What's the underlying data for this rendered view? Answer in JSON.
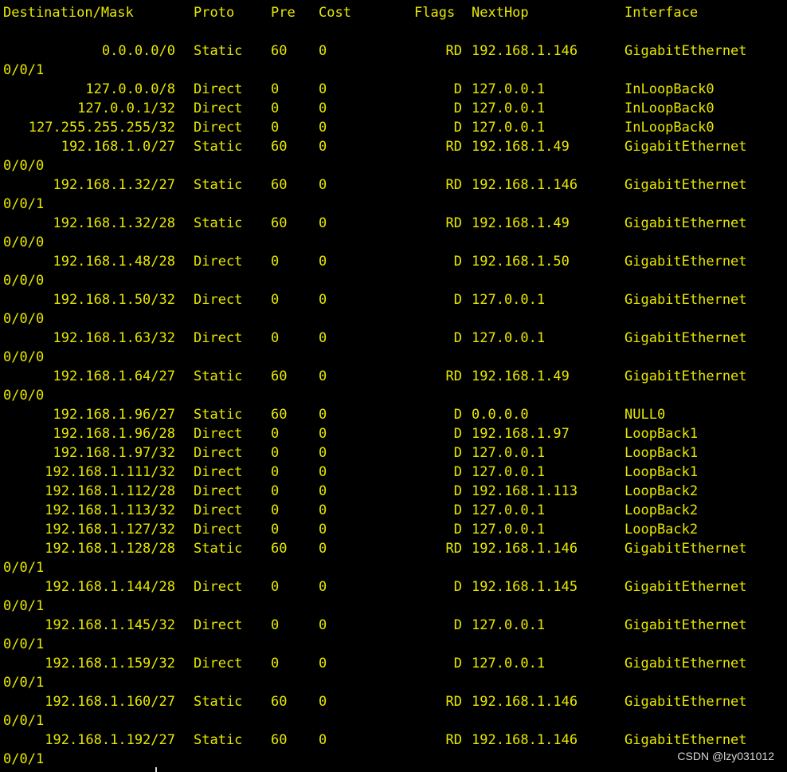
{
  "terminal": {
    "colors": {
      "background": "#000000",
      "text": "#e8e800",
      "watermark": "#d6d6d6"
    },
    "header": {
      "destination": "Destination/Mask",
      "proto": "Proto",
      "pre": "Pre",
      "cost": "Cost",
      "flags": "Flags",
      "nexthop": "NextHop",
      "interface": "Interface"
    },
    "routes": [
      {
        "dest": "0.0.0.0/0",
        "proto": "Static",
        "pre": "60",
        "cost": "0",
        "flags": "RD",
        "nexthop": "192.168.1.146",
        "iface": "GigabitEthernet",
        "iface_wrap": "0/0/1"
      },
      {
        "dest": "127.0.0.0/8",
        "proto": "Direct",
        "pre": "0",
        "cost": "0",
        "flags": "D",
        "nexthop": "127.0.0.1",
        "iface": "InLoopBack0",
        "iface_wrap": ""
      },
      {
        "dest": "127.0.0.1/32",
        "proto": "Direct",
        "pre": "0",
        "cost": "0",
        "flags": "D",
        "nexthop": "127.0.0.1",
        "iface": "InLoopBack0",
        "iface_wrap": ""
      },
      {
        "dest": "127.255.255.255/32",
        "proto": "Direct",
        "pre": "0",
        "cost": "0",
        "flags": "D",
        "nexthop": "127.0.0.1",
        "iface": "InLoopBack0",
        "iface_wrap": ""
      },
      {
        "dest": "192.168.1.0/27",
        "proto": "Static",
        "pre": "60",
        "cost": "0",
        "flags": "RD",
        "nexthop": "192.168.1.49",
        "iface": "GigabitEthernet",
        "iface_wrap": "0/0/0"
      },
      {
        "dest": "192.168.1.32/27",
        "proto": "Static",
        "pre": "60",
        "cost": "0",
        "flags": "RD",
        "nexthop": "192.168.1.146",
        "iface": "GigabitEthernet",
        "iface_wrap": "0/0/1"
      },
      {
        "dest": "192.168.1.32/28",
        "proto": "Static",
        "pre": "60",
        "cost": "0",
        "flags": "RD",
        "nexthop": "192.168.1.49",
        "iface": "GigabitEthernet",
        "iface_wrap": "0/0/0"
      },
      {
        "dest": "192.168.1.48/28",
        "proto": "Direct",
        "pre": "0",
        "cost": "0",
        "flags": "D",
        "nexthop": "192.168.1.50",
        "iface": "GigabitEthernet",
        "iface_wrap": "0/0/0"
      },
      {
        "dest": "192.168.1.50/32",
        "proto": "Direct",
        "pre": "0",
        "cost": "0",
        "flags": "D",
        "nexthop": "127.0.0.1",
        "iface": "GigabitEthernet",
        "iface_wrap": "0/0/0"
      },
      {
        "dest": "192.168.1.63/32",
        "proto": "Direct",
        "pre": "0",
        "cost": "0",
        "flags": "D",
        "nexthop": "127.0.0.1",
        "iface": "GigabitEthernet",
        "iface_wrap": "0/0/0"
      },
      {
        "dest": "192.168.1.64/27",
        "proto": "Static",
        "pre": "60",
        "cost": "0",
        "flags": "RD",
        "nexthop": "192.168.1.49",
        "iface": "GigabitEthernet",
        "iface_wrap": "0/0/0"
      },
      {
        "dest": "192.168.1.96/27",
        "proto": "Static",
        "pre": "60",
        "cost": "0",
        "flags": "D",
        "nexthop": "0.0.0.0",
        "iface": "NULL0",
        "iface_wrap": ""
      },
      {
        "dest": "192.168.1.96/28",
        "proto": "Direct",
        "pre": "0",
        "cost": "0",
        "flags": "D",
        "nexthop": "192.168.1.97",
        "iface": "LoopBack1",
        "iface_wrap": ""
      },
      {
        "dest": "192.168.1.97/32",
        "proto": "Direct",
        "pre": "0",
        "cost": "0",
        "flags": "D",
        "nexthop": "127.0.0.1",
        "iface": "LoopBack1",
        "iface_wrap": ""
      },
      {
        "dest": "192.168.1.111/32",
        "proto": "Direct",
        "pre": "0",
        "cost": "0",
        "flags": "D",
        "nexthop": "127.0.0.1",
        "iface": "LoopBack1",
        "iface_wrap": ""
      },
      {
        "dest": "192.168.1.112/28",
        "proto": "Direct",
        "pre": "0",
        "cost": "0",
        "flags": "D",
        "nexthop": "192.168.1.113",
        "iface": "LoopBack2",
        "iface_wrap": ""
      },
      {
        "dest": "192.168.1.113/32",
        "proto": "Direct",
        "pre": "0",
        "cost": "0",
        "flags": "D",
        "nexthop": "127.0.0.1",
        "iface": "LoopBack2",
        "iface_wrap": ""
      },
      {
        "dest": "192.168.1.127/32",
        "proto": "Direct",
        "pre": "0",
        "cost": "0",
        "flags": "D",
        "nexthop": "127.0.0.1",
        "iface": "LoopBack2",
        "iface_wrap": ""
      },
      {
        "dest": "192.168.1.128/28",
        "proto": "Static",
        "pre": "60",
        "cost": "0",
        "flags": "RD",
        "nexthop": "192.168.1.146",
        "iface": "GigabitEthernet",
        "iface_wrap": "0/0/1"
      },
      {
        "dest": "192.168.1.144/28",
        "proto": "Direct",
        "pre": "0",
        "cost": "0",
        "flags": "D",
        "nexthop": "192.168.1.145",
        "iface": "GigabitEthernet",
        "iface_wrap": "0/0/1"
      },
      {
        "dest": "192.168.1.145/32",
        "proto": "Direct",
        "pre": "0",
        "cost": "0",
        "flags": "D",
        "nexthop": "127.0.0.1",
        "iface": "GigabitEthernet",
        "iface_wrap": "0/0/1"
      },
      {
        "dest": "192.168.1.159/32",
        "proto": "Direct",
        "pre": "0",
        "cost": "0",
        "flags": "D",
        "nexthop": "127.0.0.1",
        "iface": "GigabitEthernet",
        "iface_wrap": "0/0/1"
      },
      {
        "dest": "192.168.1.160/27",
        "proto": "Static",
        "pre": "60",
        "cost": "0",
        "flags": "RD",
        "nexthop": "192.168.1.146",
        "iface": "GigabitEthernet",
        "iface_wrap": "0/0/1"
      },
      {
        "dest": "192.168.1.192/27",
        "proto": "Static",
        "pre": "60",
        "cost": "0",
        "flags": "RD",
        "nexthop": "192.168.1.146",
        "iface": "GigabitEthernet",
        "iface_wrap": "0/0/1"
      }
    ]
  },
  "watermark": "CSDN @lzy031012"
}
